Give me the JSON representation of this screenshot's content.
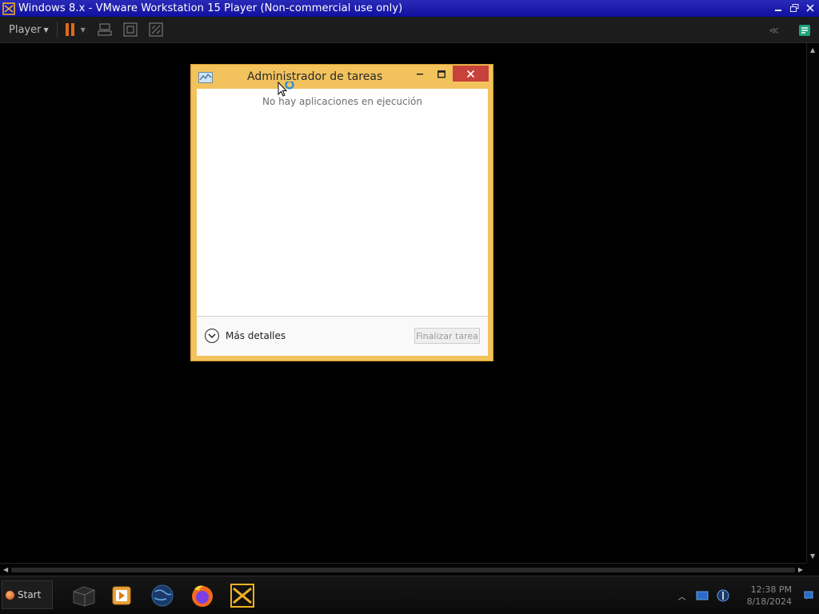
{
  "host": {
    "title": "Windows 8.x - VMware Workstation 15 Player (Non-commercial use only)",
    "toolbar": {
      "player_label": "Player",
      "collapse_label": "≪"
    }
  },
  "task_manager": {
    "title": "Administrador de tareas",
    "empty_message": "No hay aplicaciones en ejecución",
    "more_details_label": "Más detalles",
    "end_task_label": "Finalizar tarea"
  },
  "taskbar": {
    "start_label": "Start",
    "apps": [
      "file-manager-icon",
      "media-player-icon",
      "browser-globe-icon",
      "firefox-icon",
      "vmware-icon"
    ],
    "clock": {
      "time": "12:38 PM",
      "date": "8/18/2024"
    }
  },
  "colors": {
    "host_titlebar": "#1a1aa8",
    "task_manager_frame": "#f2c25c",
    "close_button": "#c7423a",
    "pause_accent": "#e06a1a"
  }
}
